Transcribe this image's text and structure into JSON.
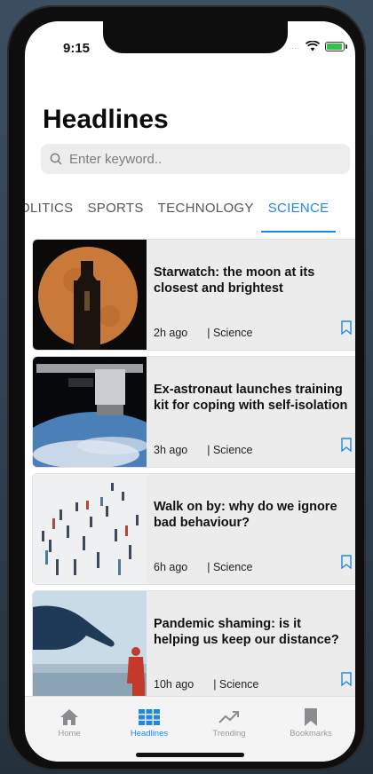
{
  "status": {
    "time": "9:15",
    "signal": "...."
  },
  "page": {
    "title": "Headlines"
  },
  "search": {
    "placeholder": "Enter keyword.."
  },
  "tabs": [
    {
      "label": "OLITICS",
      "active": false
    },
    {
      "label": "SPORTS",
      "active": false
    },
    {
      "label": "TECHNOLOGY",
      "active": false
    },
    {
      "label": "SCIENCE",
      "active": true
    }
  ],
  "articles": [
    {
      "title": "Starwatch: the moon at its closest and brightest",
      "time": "2h ago",
      "category": "| Science",
      "image": "moon-image"
    },
    {
      "title": "Ex-astronaut launches training kit for coping with self-isolation",
      "time": "3h ago",
      "category": "| Science",
      "image": "spacecraft-image"
    },
    {
      "title": "Walk on by: why do we ignore bad behaviour?",
      "time": "6h ago",
      "category": "| Science",
      "image": "crowd-image"
    },
    {
      "title": "Pandemic shaming: is it helping us keep our distance?",
      "time": "10h ago",
      "category": "| Science",
      "image": "pointing-hand-image"
    }
  ],
  "tabbar": {
    "home": "Home",
    "headlines": "Headlines",
    "trending": "Trending",
    "bookmarks": "Bookmarks"
  },
  "colors": {
    "accent": "#1e88e5",
    "card_bg": "#ececed",
    "battery": "#31c34a"
  }
}
